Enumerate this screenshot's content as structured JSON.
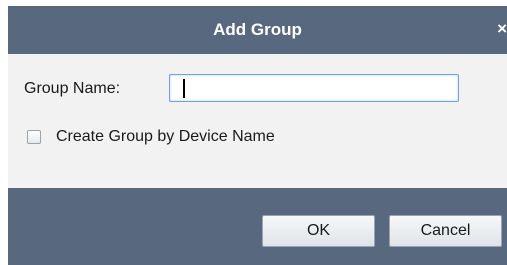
{
  "dialog": {
    "title": "Add Group",
    "close_glyph": "×"
  },
  "form": {
    "group_name_label": "Group Name:",
    "group_name_value": "",
    "create_by_device_label": "Create Group by Device Name",
    "create_by_device_checked": false
  },
  "buttons": {
    "ok_label": "OK",
    "cancel_label": "Cancel"
  },
  "colors": {
    "title_bar": "#58687f",
    "content_bg": "#f2f2f2",
    "input_border": "#6fa3d9"
  }
}
